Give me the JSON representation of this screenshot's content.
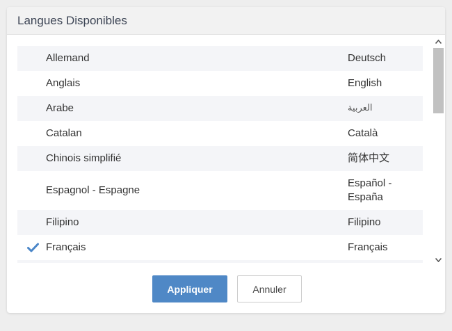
{
  "dialog": {
    "title": "Langues Disponibles"
  },
  "languages": [
    {
      "name": "Allemand",
      "native": "Deutsch",
      "selected": false
    },
    {
      "name": "Anglais",
      "native": "English",
      "selected": false
    },
    {
      "name": "Arabe",
      "native": "العربية",
      "selected": false
    },
    {
      "name": "Catalan",
      "native": "Català",
      "selected": false
    },
    {
      "name": "Chinois simplifié",
      "native": "简体中文",
      "selected": false
    },
    {
      "name": "Espagnol - Espagne",
      "native": "Español - España",
      "selected": false
    },
    {
      "name": "Filipino",
      "native": "Filipino",
      "selected": false
    },
    {
      "name": "Français",
      "native": "Français",
      "selected": true
    }
  ],
  "buttons": {
    "apply_label": "Appliquer",
    "cancel_label": "Annuler"
  },
  "colors": {
    "accent": "#4f88c6",
    "check": "#4a86c8",
    "row_alt": "#f4f5f8"
  },
  "icons": {
    "check": "checkmark-icon",
    "scroll_up": "arrow-up-icon",
    "scroll_down": "arrow-down-icon"
  }
}
